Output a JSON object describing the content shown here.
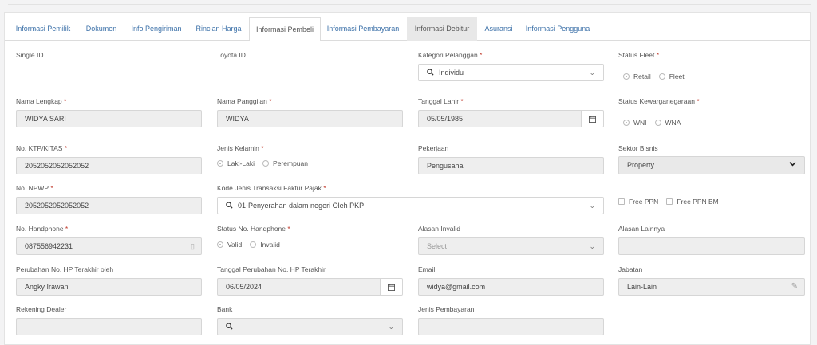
{
  "tabs": [
    {
      "label": "Informasi Pemilik"
    },
    {
      "label": "Dokumen"
    },
    {
      "label": "Info Pengiriman"
    },
    {
      "label": "Rincian Harga"
    },
    {
      "label": "Informasi Pembeli"
    },
    {
      "label": "Informasi Pembayaran"
    },
    {
      "label": "Informasi Debitur"
    },
    {
      "label": "Asuransi"
    },
    {
      "label": "Informasi Pengguna"
    }
  ],
  "required_mark": "*",
  "fields": {
    "single_id": {
      "label": "Single ID"
    },
    "toyota_id": {
      "label": "Toyota ID"
    },
    "kategori_pelanggan": {
      "label": "Kategori Pelanggan",
      "value": "Individu"
    },
    "status_fleet": {
      "label": "Status Fleet",
      "options": [
        "Retail",
        "Fleet"
      ],
      "selected": "Retail"
    },
    "nama_lengkap": {
      "label": "Nama Lengkap",
      "value": "WIDYA SARI"
    },
    "nama_panggilan": {
      "label": "Nama Panggilan",
      "value": "WIDYA"
    },
    "tanggal_lahir": {
      "label": "Tanggal Lahir",
      "value": "05/05/1985"
    },
    "status_kewarganegaraan": {
      "label": "Status Kewarganegaraan",
      "options": [
        "WNI",
        "WNA"
      ],
      "selected": "WNI"
    },
    "no_ktp": {
      "label": "No. KTP/KITAS",
      "value": "2052052052052052"
    },
    "jenis_kelamin": {
      "label": "Jenis Kelamin",
      "options": [
        "Laki-Laki",
        "Perempuan"
      ],
      "selected": "Laki-Laki"
    },
    "pekerjaan": {
      "label": "Pekerjaan",
      "value": "Pengusaha"
    },
    "sektor_bisnis": {
      "label": "Sektor Bisnis",
      "value": "Property"
    },
    "no_npwp": {
      "label": "No. NPWP",
      "value": "2052052052052052"
    },
    "kode_jenis_transaksi": {
      "label": "Kode Jenis Transaksi Faktur Pajak",
      "value": "01-Penyerahan dalam negeri Oleh PKP"
    },
    "free_ppn": {
      "label": "Free PPN"
    },
    "free_ppn_bm": {
      "label": "Free PPN BM"
    },
    "no_handphone": {
      "label": "No. Handphone",
      "value": "087556942231"
    },
    "status_no_handphone": {
      "label": "Status No. Handphone",
      "options": [
        "Valid",
        "Invalid"
      ],
      "selected": "Valid"
    },
    "alasan_invalid": {
      "label": "Alasan Invalid",
      "placeholder": "Select"
    },
    "alasan_lainnya": {
      "label": "Alasan Lainnya"
    },
    "perubahan_hp_oleh": {
      "label": "Perubahan No. HP Terakhir oleh",
      "value": "Angky Irawan"
    },
    "tanggal_perubahan_hp": {
      "label": "Tanggal Perubahan No. HP Terakhir",
      "value": "06/05/2024"
    },
    "email": {
      "label": "Email",
      "value": "widya@gmail.com"
    },
    "jabatan": {
      "label": "Jabatan",
      "value": "Lain-Lain"
    },
    "rekening_dealer": {
      "label": "Rekening Dealer"
    },
    "bank": {
      "label": "Bank"
    },
    "jenis_pembayaran": {
      "label": "Jenis Pembayaran"
    }
  },
  "icons": {
    "search": "search-icon",
    "calendar": "calendar-icon",
    "chevron": "chevron-down-icon",
    "pencil": "pencil-icon",
    "phone": "phone-icon"
  }
}
